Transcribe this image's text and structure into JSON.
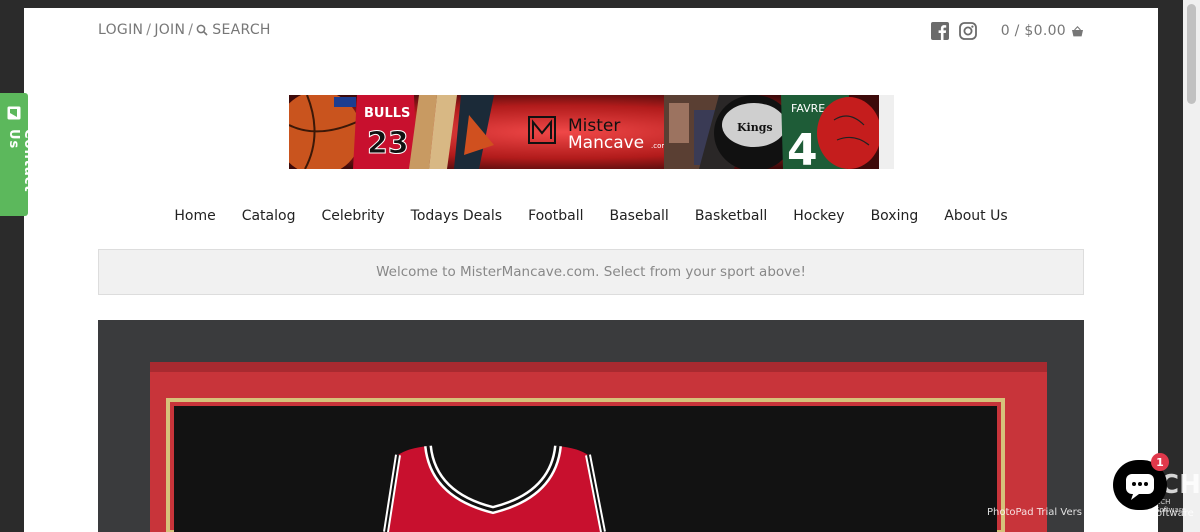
{
  "header": {
    "login_label": "LOGIN",
    "separator": "/",
    "join_label": "JOIN",
    "search_label": "SEARCH",
    "cart_text": "0 / $0.00"
  },
  "banner": {
    "brand_line1": "Mister",
    "brand_line2": "Mancave",
    "brand_suffix": ".com",
    "jersey_team": "BULLS",
    "jersey_number": "23",
    "jersey2_name": "FAVRE",
    "jersey2_number": "4",
    "puck_text": "Kings"
  },
  "nav": {
    "items": [
      "Home",
      "Catalog",
      "Celebrity",
      "Todays Deals",
      "Football",
      "Baseball",
      "Basketball",
      "Hockey",
      "Boxing",
      "About Us"
    ]
  },
  "welcome": {
    "message": "Welcome to MisterMancave.com. Select from your sport above!"
  },
  "contact_tab": {
    "label": "Contact Us"
  },
  "chat": {
    "badge_count": "1"
  },
  "watermark": {
    "text": "PhotoPad Trial Vers",
    "logo": "CH",
    "sub": "NCH Software",
    "sub2": "oftware"
  },
  "colors": {
    "contact_green": "#5cb85c",
    "badge_red": "#e0384b",
    "jersey_red": "#c8102e"
  }
}
